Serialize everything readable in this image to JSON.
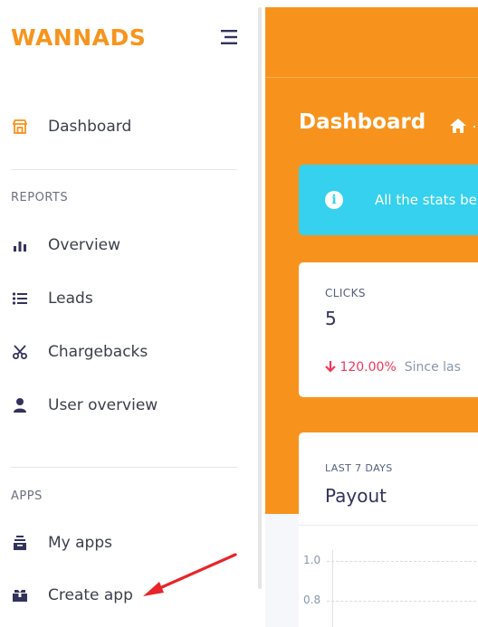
{
  "sidebar": {
    "logo": "WANNADS",
    "items_top": [
      {
        "label": "Dashboard",
        "icon": "store-icon"
      }
    ],
    "section_reports": "REPORTS",
    "reports": [
      {
        "label": "Overview",
        "icon": "bar-chart-icon"
      },
      {
        "label": "Leads",
        "icon": "list-icon"
      },
      {
        "label": "Chargebacks",
        "icon": "scissors-icon"
      },
      {
        "label": "User overview",
        "icon": "user-icon"
      }
    ],
    "section_apps": "APPS",
    "apps": [
      {
        "label": "My apps",
        "icon": "archive-icon"
      },
      {
        "label": "Create app",
        "icon": "create-box-icon"
      }
    ]
  },
  "main": {
    "title": "Dashboard",
    "alert_text": "All the stats be",
    "clicks_card": {
      "label": "CLICKS",
      "value": "5",
      "change": "120.00%",
      "since": "Since las"
    },
    "payout_card": {
      "label": "LAST 7 DAYS",
      "title": "Payout",
      "ticks": [
        "1.0",
        "0.8"
      ]
    }
  },
  "colors": {
    "accent": "#f7931d",
    "alert": "#35d1ee",
    "negative": "#f5365c",
    "annotation_arrow": "#e8242a"
  }
}
